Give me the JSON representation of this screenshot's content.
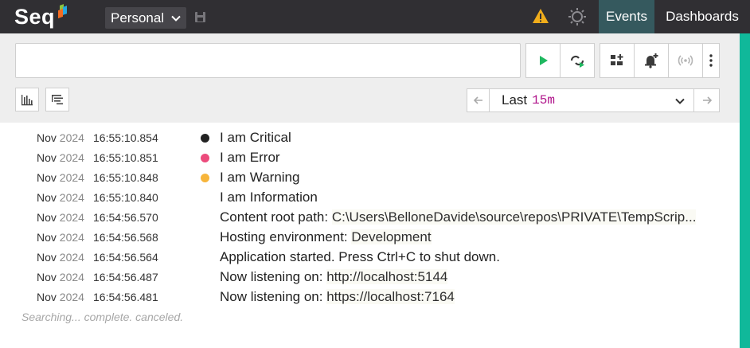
{
  "app": {
    "logo_text": "Seq"
  },
  "nav": {
    "workspace": "Personal",
    "events_label": "Events",
    "dashboards_label": "Dashboards"
  },
  "search": {
    "value": "",
    "placeholder": ""
  },
  "range": {
    "label": "Last",
    "value": "15m"
  },
  "events": [
    {
      "date": "Nov",
      "year": "2024",
      "time": "16:55:10.854",
      "level": "critical",
      "color": "#222222",
      "msg": "I am Critical",
      "prop": ""
    },
    {
      "date": "Nov",
      "year": "2024",
      "time": "16:55:10.851",
      "level": "error",
      "color": "#ec4b7c",
      "msg": "I am Error",
      "prop": ""
    },
    {
      "date": "Nov",
      "year": "2024",
      "time": "16:55:10.848",
      "level": "warning",
      "color": "#f7b53b",
      "msg": "I am Warning",
      "prop": ""
    },
    {
      "date": "Nov",
      "year": "2024",
      "time": "16:55:10.840",
      "level": "information",
      "color": "",
      "msg": "I am Information",
      "prop": ""
    },
    {
      "date": "Nov",
      "year": "2024",
      "time": "16:54:56.570",
      "level": "information",
      "color": "",
      "msg": "Content root path: ",
      "prop": "C:\\Users\\BelloneDavide\\source\\repos\\PRIVATE\\TempScrip..."
    },
    {
      "date": "Nov",
      "year": "2024",
      "time": "16:54:56.568",
      "level": "information",
      "color": "",
      "msg": "Hosting environment: ",
      "prop": "Development"
    },
    {
      "date": "Nov",
      "year": "2024",
      "time": "16:54:56.564",
      "level": "information",
      "color": "",
      "msg": "Application started. Press Ctrl+C to shut down.",
      "prop": ""
    },
    {
      "date": "Nov",
      "year": "2024",
      "time": "16:54:56.487",
      "level": "information",
      "color": "",
      "msg": "Now listening on: ",
      "prop": "http://localhost:5144"
    },
    {
      "date": "Nov",
      "year": "2024",
      "time": "16:54:56.481",
      "level": "information",
      "color": "",
      "msg": "Now listening on: ",
      "prop": "https://localhost:7164"
    }
  ],
  "status_text": "Searching... complete. canceled.",
  "colors": {
    "topbar": "#302f33",
    "active_tab": "#35595e",
    "accent": "#10b89a",
    "warning": "#f0ad1b",
    "run": "#1fb860"
  }
}
